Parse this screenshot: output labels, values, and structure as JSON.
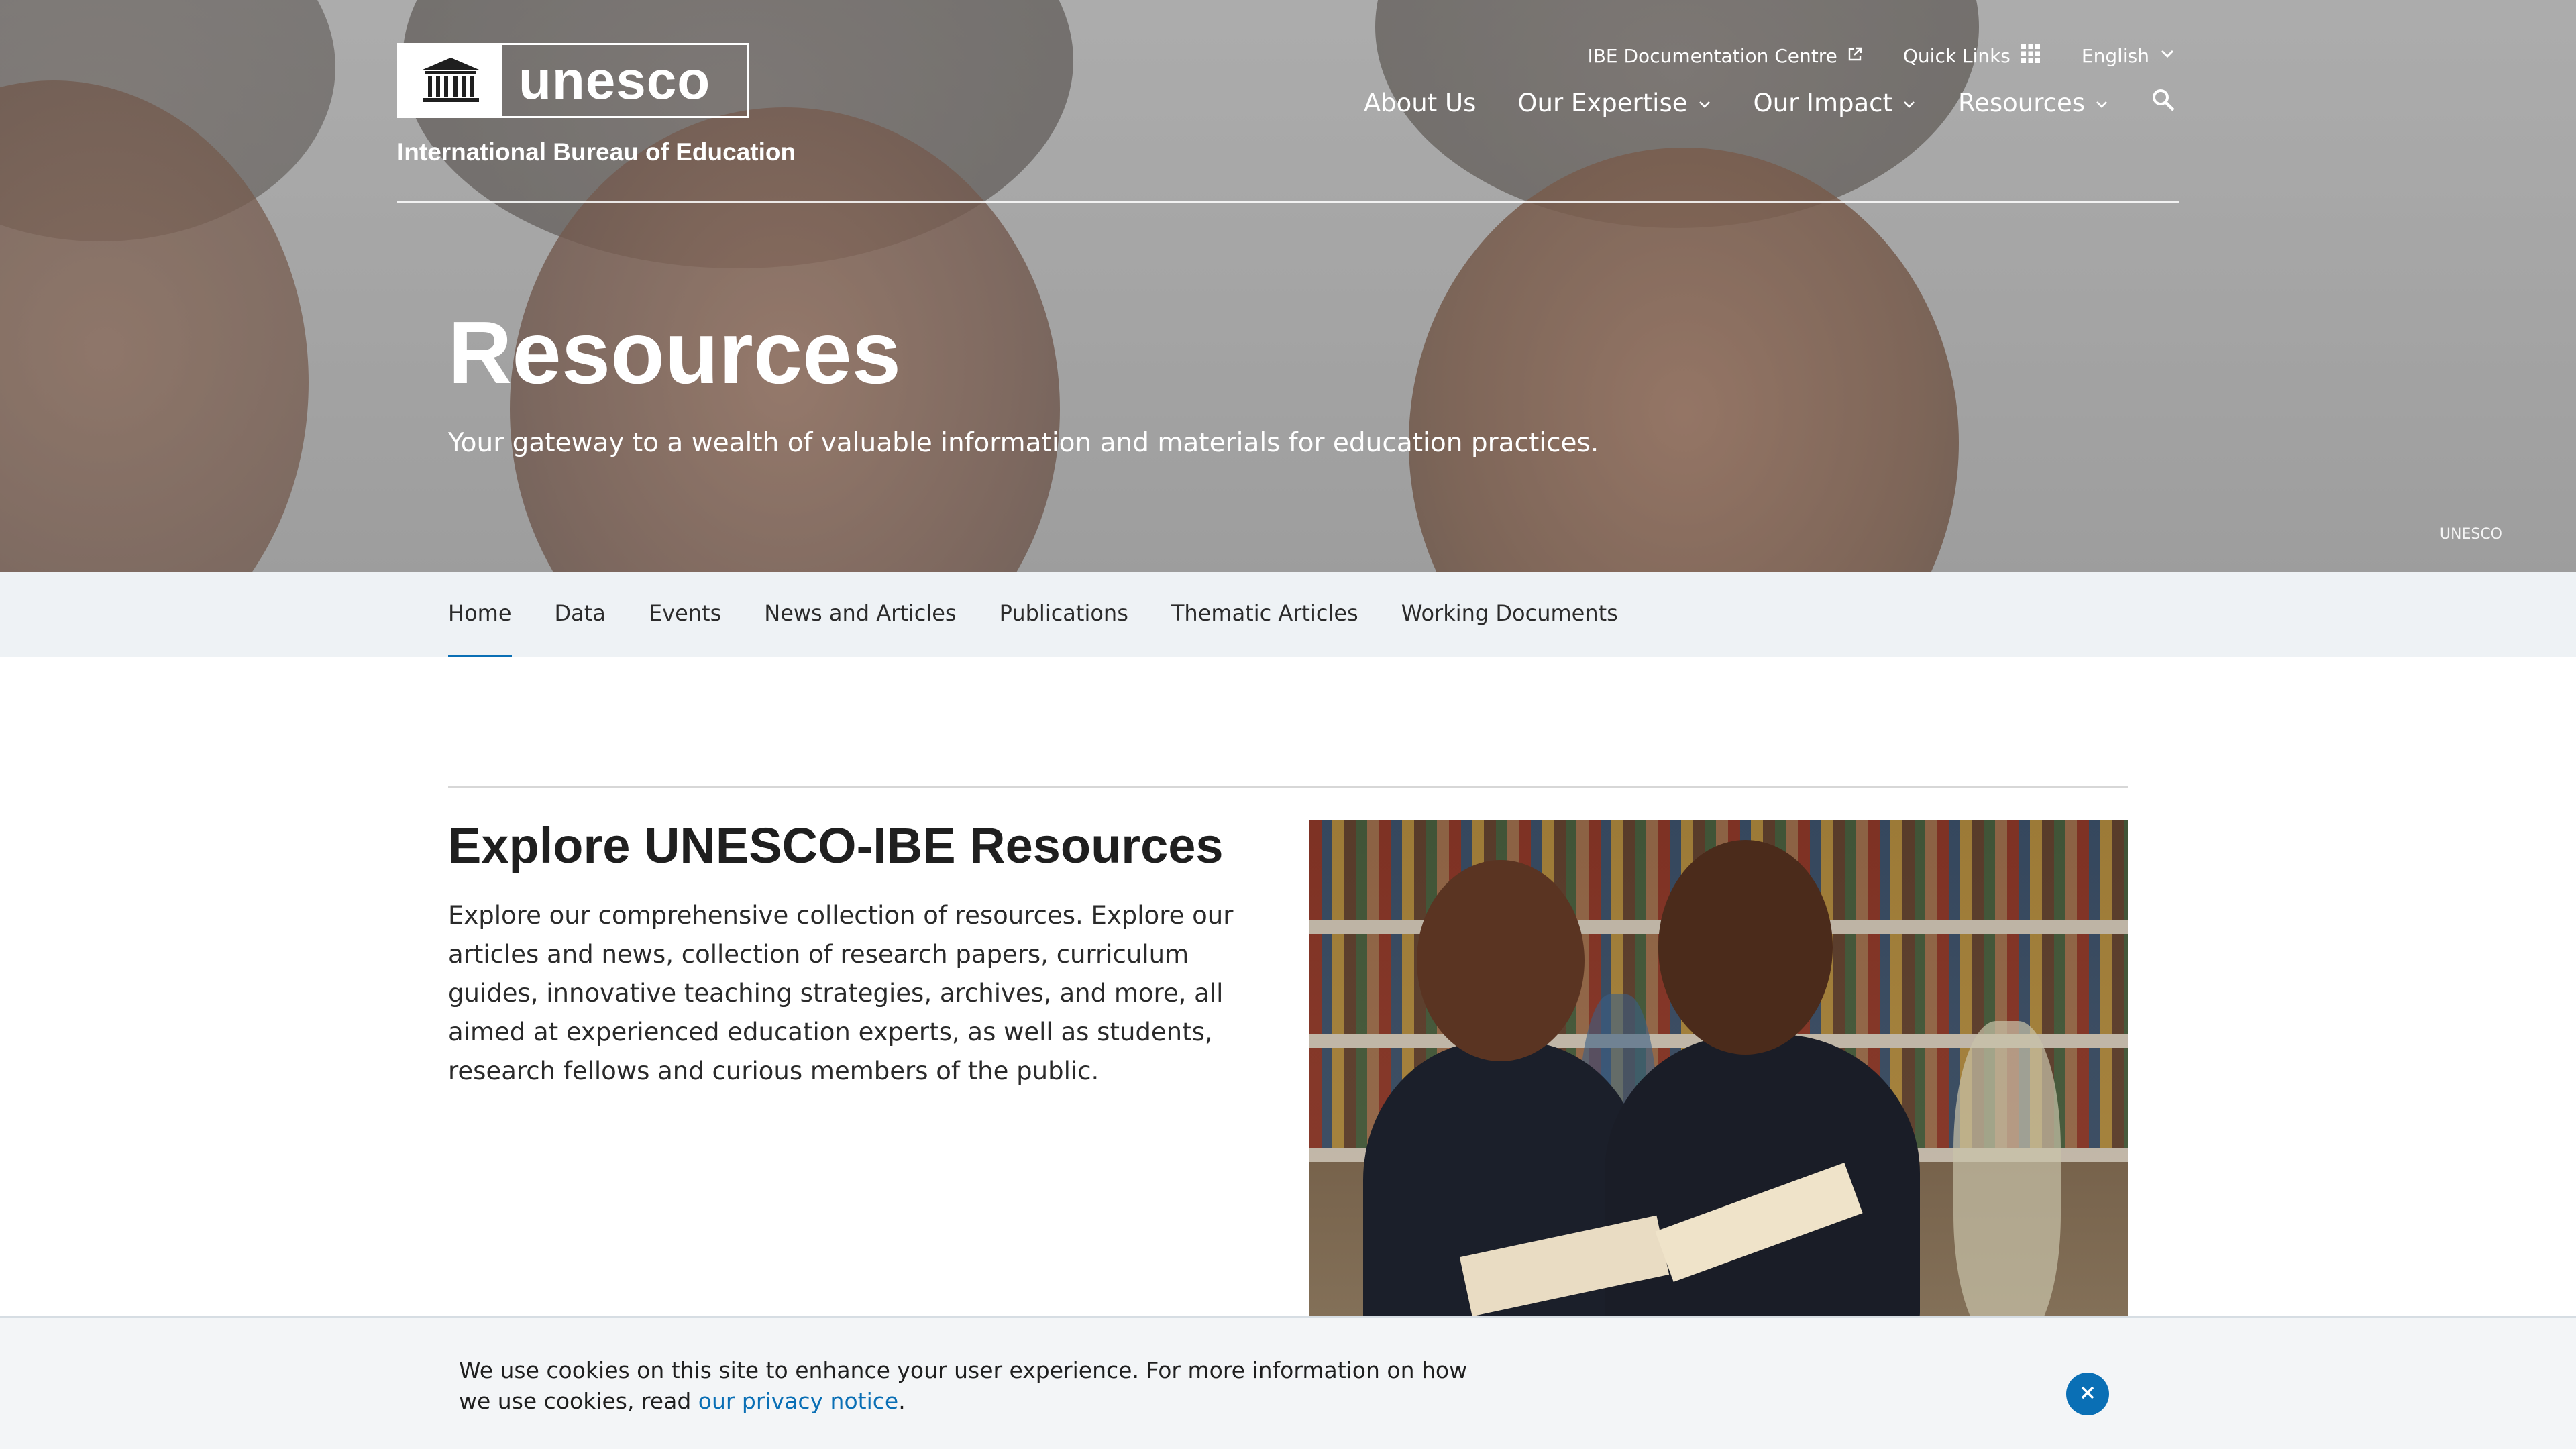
{
  "header": {
    "logo_word": "unesco",
    "org_name": "International Bureau of Education",
    "utility": {
      "doc_centre": "IBE Documentation Centre",
      "quick_links": "Quick Links",
      "language": "English"
    },
    "nav": [
      "About Us",
      "Our Expertise",
      "Our Impact",
      "Resources"
    ]
  },
  "hero": {
    "title": "Resources",
    "subtitle": "Your gateway to a wealth of valuable information and materials for education practices.",
    "credit": "UNESCO"
  },
  "subnav": {
    "tabs": [
      "Home",
      "Data",
      "Events",
      "News and Articles",
      "Publications",
      "Thematic Articles",
      "Working Documents"
    ],
    "active": "Home"
  },
  "main": {
    "title": "Explore UNESCO-IBE Resources",
    "body": "Explore our comprehensive collection of resources. Explore our articles and news, collection of research papers, curriculum guides, innovative teaching strategies, archives, and more, all aimed at experienced education experts, as well as students, research fellows and curious members of the public."
  },
  "cookie": {
    "text_before": "We use cookies on this site to enhance your user experience. For more information on how we use cookies, read ",
    "link_text": "our privacy notice",
    "text_after": "."
  },
  "colors": {
    "accent": "#0a6fb5",
    "subnav_bg": "#eef2f5",
    "cookie_bg": "#f3f5f7"
  },
  "icons": [
    "external-link-icon",
    "grid-icon",
    "chevron-down-icon",
    "search-icon",
    "close-icon",
    "unesco-temple-icon"
  ]
}
